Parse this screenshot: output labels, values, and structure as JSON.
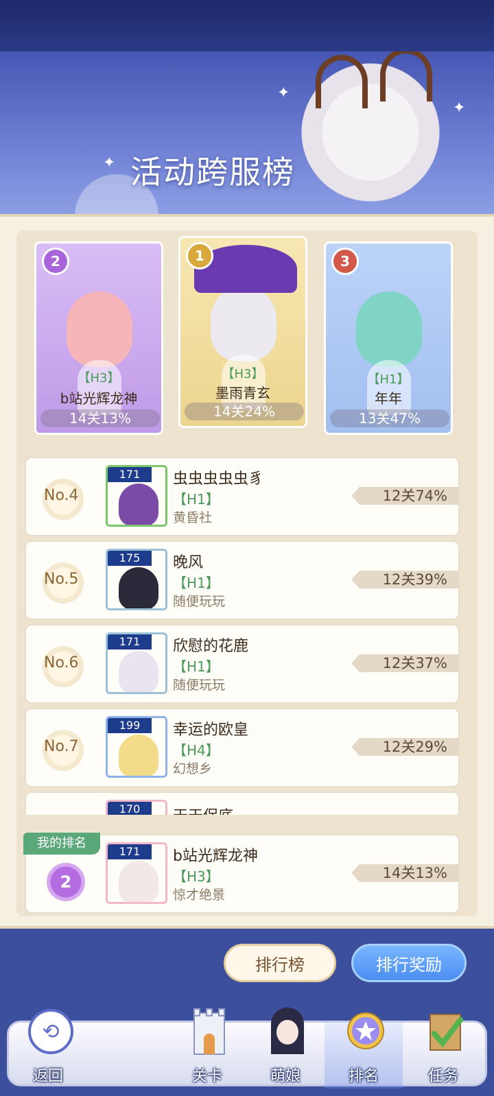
{
  "banner": {
    "title": "活动跨服榜"
  },
  "podium": [
    {
      "rank": "2",
      "tag": "【H3】",
      "name": "b站光辉龙神",
      "score": "14关13%",
      "color": "#c9a4ee",
      "medal_color": "#a864d8"
    },
    {
      "rank": "1",
      "tag": "【H3】",
      "name": "墨雨青玄",
      "score": "14关24%",
      "color": "#f3dfa0",
      "medal_color": "#d8a93a"
    },
    {
      "rank": "3",
      "tag": "【H1】",
      "name": "年年",
      "score": "13关47%",
      "color": "#a9c6f4",
      "medal_color": "#d2594a"
    }
  ],
  "rows": [
    {
      "rank": "No.4",
      "level": "171",
      "name": "虫虫虫虫虫豸",
      "tag": "【H1】",
      "guild": "黄昏社",
      "score": "12关74%"
    },
    {
      "rank": "No.5",
      "level": "175",
      "name": "晚风",
      "tag": "【H1】",
      "guild": "随便玩玩",
      "score": "12关39%"
    },
    {
      "rank": "No.6",
      "level": "171",
      "name": "欣慰的花鹿",
      "tag": "【H1】",
      "guild": "随便玩玩",
      "score": "12关37%"
    },
    {
      "rank": "No.7",
      "level": "199",
      "name": "幸运的欧皇",
      "tag": "【H4】",
      "guild": "幻想乡",
      "score": "12关29%"
    },
    {
      "rank": "",
      "level": "170",
      "name": "天天保底",
      "tag": "",
      "guild": "",
      "score": ""
    }
  ],
  "mine": {
    "label": "我的排名",
    "rank": "2",
    "level": "171",
    "name": "b站光辉龙神",
    "tag": "【H3】",
    "guild": "惊才绝景",
    "score": "14关13%"
  },
  "buttons": {
    "leaderboard": "排行榜",
    "rewards": "排行奖励"
  },
  "nav": {
    "back": "返回",
    "stage": "关卡",
    "girls": "萌娘",
    "ranking": "排名",
    "tasks": "任务"
  }
}
